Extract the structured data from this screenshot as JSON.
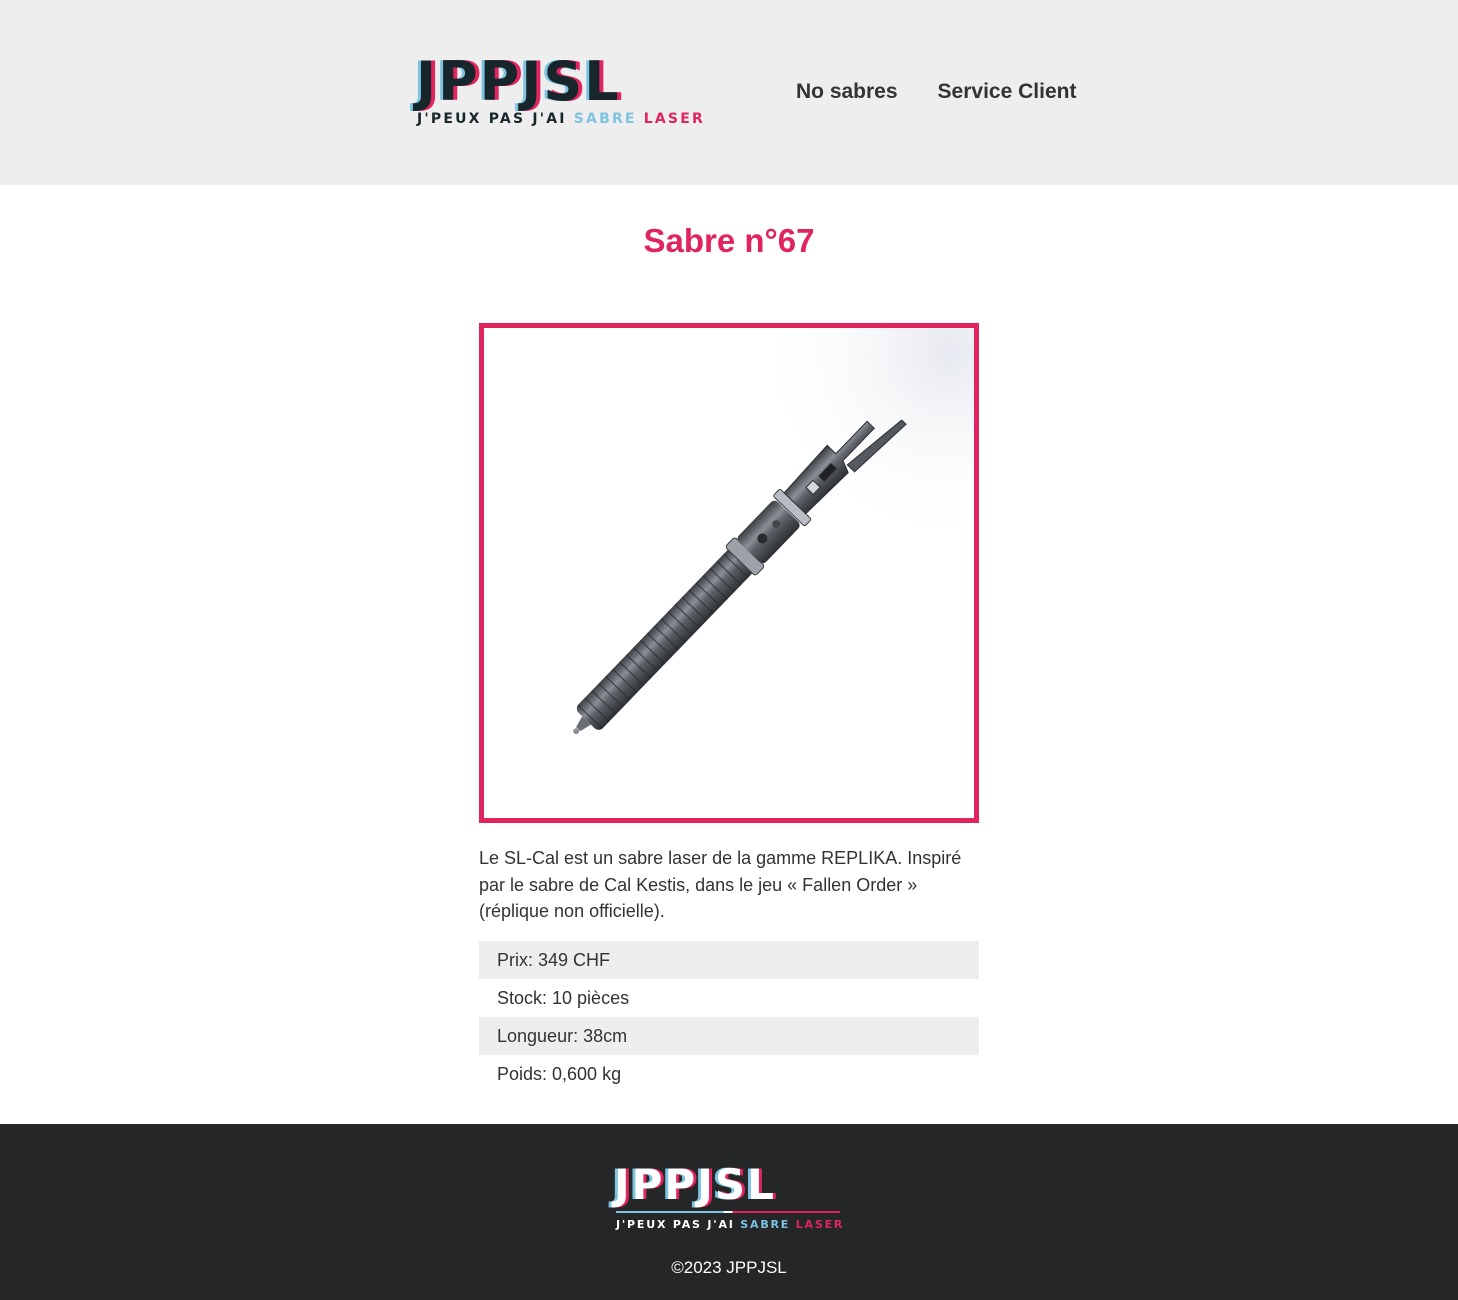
{
  "header": {
    "logo": {
      "wordmark": "JPPJSL",
      "tagline_prefix": "J'PEUX PAS J'AI ",
      "tagline_blue": "SABRE",
      "tagline_red": " LASER"
    },
    "nav": {
      "items": [
        {
          "label": "No sabres"
        },
        {
          "label": "Service Client"
        }
      ]
    }
  },
  "main": {
    "title": "Sabre n°67",
    "product_image": {
      "subject": "lightsaber hilt",
      "alt": "SL-Cal"
    },
    "description": "Le SL-Cal est un sabre laser de la gamme REPLIKA. Inspiré par le sabre de Cal Kestis, dans le jeu « Fallen Order » (réplique non officielle).",
    "specs": [
      {
        "text": "Prix: 349 CHF"
      },
      {
        "text": "Stock: 10 pièces"
      },
      {
        "text": "Longueur: 38cm"
      },
      {
        "text": "Poids: 0,600 kg"
      }
    ]
  },
  "footer": {
    "logo": {
      "wordmark": "JPPJSL",
      "tagline_prefix": "J'PEUX PAS J'AI ",
      "tagline_blue": "SABRE",
      "tagline_red": " LASER"
    },
    "copyright": "©2023 JPPJSL"
  },
  "colors": {
    "accent": "#e0245e",
    "accent_blue": "#7ec4e0",
    "header_bg": "#eeeeee",
    "footer_bg": "#242628",
    "text": "#333333"
  }
}
